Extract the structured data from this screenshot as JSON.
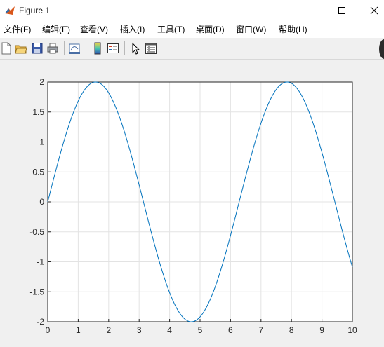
{
  "window": {
    "title": "Figure 1",
    "icon": "matlab-icon",
    "controls": [
      "minimize-icon",
      "maximize-icon",
      "close-icon"
    ]
  },
  "menubar": {
    "items": [
      {
        "label": "文件(F)"
      },
      {
        "label": "编辑(E)"
      },
      {
        "label": "查看(V)"
      },
      {
        "label": "插入(I)"
      },
      {
        "label": "工具(T)"
      },
      {
        "label": "桌面(D)"
      },
      {
        "label": "窗口(W)"
      },
      {
        "label": "帮助(H)"
      }
    ]
  },
  "toolbar": {
    "icons": [
      "new-figure-icon",
      "open-file-icon",
      "save-icon",
      "print-icon",
      "link-plot-icon",
      "insert-colorbar-icon",
      "insert-legend-icon",
      "pointer-icon",
      "property-inspector-icon"
    ]
  },
  "colors": {
    "line": "#0072BD",
    "grid": "#e3e3e3",
    "axes_bg": "#ffffff",
    "figure_bg": "#f0f0f0"
  },
  "chart_data": {
    "type": "line",
    "function": "2*sin(x)",
    "x_range": [
      0,
      10
    ],
    "series": [
      {
        "x": [
          0,
          0.5,
          1,
          1.5,
          1.5708,
          2,
          2.5,
          3,
          3.5,
          4,
          4.5,
          4.7124,
          5,
          5.5,
          6,
          6.5,
          7,
          7.5,
          7.854,
          8,
          8.5,
          9,
          9.5,
          10
        ],
        "values": [
          0,
          0.959,
          1.683,
          1.995,
          2,
          1.819,
          1.197,
          0.282,
          -0.702,
          -1.514,
          -1.955,
          -2,
          -1.918,
          -1.411,
          -0.559,
          0.43,
          1.314,
          1.876,
          2,
          1.979,
          1.596,
          0.824,
          -0.15,
          -1.088
        ]
      }
    ],
    "xlim": [
      0,
      10
    ],
    "ylim": [
      -2,
      2
    ],
    "xticks": [
      "0",
      "1",
      "2",
      "3",
      "4",
      "5",
      "6",
      "7",
      "8",
      "9",
      "10"
    ],
    "yticks": [
      "2",
      "1.5",
      "1",
      "0.5",
      "0",
      "-0.5",
      "-1",
      "-1.5",
      "-2"
    ],
    "ytick_values": [
      2,
      1.5,
      1,
      0.5,
      0,
      -0.5,
      -1,
      -1.5,
      -2
    ],
    "grid": true
  }
}
